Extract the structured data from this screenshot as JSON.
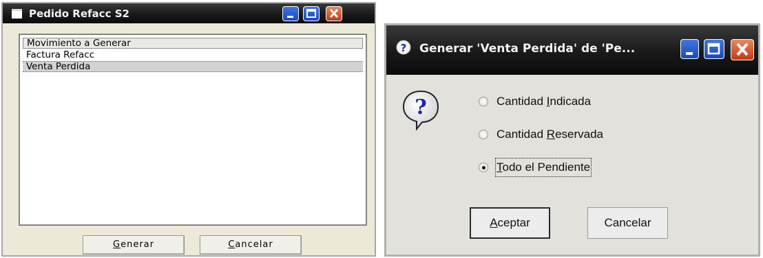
{
  "dialog_left": {
    "title": "Pedido Refacc S2",
    "list": {
      "header": "Movimiento a Generar",
      "items": [
        "Factura Refacc",
        "Venta Perdida"
      ],
      "selected_index": 1
    },
    "buttons": {
      "generate": {
        "mnemonic": "G",
        "rest": "enerar"
      },
      "cancel": {
        "mnemonic": "C",
        "rest": "ancelar"
      }
    }
  },
  "dialog_right": {
    "title": "Generar 'Venta Perdida' de 'Pe...",
    "options": [
      {
        "pre": "Cantidad ",
        "mnemonic": "I",
        "post": "ndicada",
        "checked": false
      },
      {
        "pre": "Cantidad ",
        "mnemonic": "R",
        "post": "eservada",
        "checked": false
      },
      {
        "pre": "",
        "mnemonic": "T",
        "post": "odo el Pendiente",
        "checked": true
      }
    ],
    "buttons": {
      "accept": {
        "mnemonic": "A",
        "rest": "ceptar"
      },
      "cancel_label": "Cancelar"
    }
  },
  "colors": {
    "title_bar": "#1a1a1a",
    "minimize_maximize": "#2a5fd6",
    "close": "#d4532a"
  }
}
